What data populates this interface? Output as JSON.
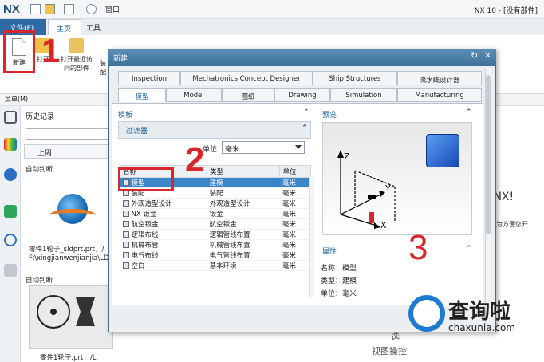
{
  "app": {
    "logo": "NX",
    "window_menu": "窗口",
    "title": "NX 10 - [没有部件]"
  },
  "ribbon_tabs": {
    "file": "文件(F)",
    "home": "主页",
    "tools": "工具"
  },
  "ribbon": {
    "new_label": "新建",
    "open_label": "打开",
    "recent_label_1": "打开最近访",
    "recent_label_2": "问的部件",
    "assembly_label": "装配"
  },
  "annotations": {
    "one": "1",
    "two": "2",
    "three": "3"
  },
  "cmdbar": {
    "menu_label": "菜单(M)"
  },
  "history": {
    "title": "历史记录",
    "group": "上周",
    "auto_label_1": "自动判断",
    "file1_name": "零件1轮子_sldprt.prt，/",
    "file1_path": "F:\\xingjianwenjianjia\\LD",
    "auto_label_2": "自动判断",
    "file2_name": "零件1轮子.prt，/L"
  },
  "right_area": {
    "heading": "用 NX!",
    "sub": "，为方便您开",
    "view_top": "选",
    "view_bottom": "视图操控"
  },
  "dialog": {
    "title": "新建",
    "tabs_row1": [
      "Inspection",
      "Mechatronics Concept Designer",
      "Ship Structures",
      "流水线设计器"
    ],
    "tabs_row2": [
      "模型",
      "Model",
      "图纸",
      "Drawing",
      "Simulation",
      "Manufacturing"
    ],
    "templates_title": "模板",
    "filter_title": "过滤器",
    "unit_label": "单位",
    "unit_value": "毫米",
    "table": {
      "headers": [
        "名称",
        "类型",
        "单位"
      ],
      "rows": [
        [
          "模型",
          "建模",
          "毫米"
        ],
        [
          "装配",
          "装配",
          "毫米"
        ],
        [
          "外观造型设计",
          "外观造型设计",
          "毫米"
        ],
        [
          "NX 钣金",
          "钣金",
          "毫米"
        ],
        [
          "航空钣金",
          "航空钣金",
          "毫米"
        ],
        [
          "逻辑布线",
          "逻辑管线布置",
          "毫米"
        ],
        [
          "机械布管",
          "机械管线布置",
          "毫米"
        ],
        [
          "电气布线",
          "电气管线布置",
          "毫米"
        ],
        [
          "空白",
          "基本环境",
          "毫米"
        ]
      ]
    },
    "preview_title": "预览",
    "properties_title": "属性",
    "properties": [
      {
        "label": "名称：",
        "value": "模型"
      },
      {
        "label": "类型：",
        "value": "建模"
      },
      {
        "label": "单位：",
        "value": "毫米"
      }
    ],
    "axes": {
      "z": "Z",
      "y": "Y",
      "x": "X"
    }
  },
  "watermark": {
    "text": "查询啦",
    "url": "chaxunla.com"
  },
  "colors": {
    "accent": "#2f6aa5",
    "annotation_red": "#d8262a",
    "selection": "#3b86c9"
  }
}
